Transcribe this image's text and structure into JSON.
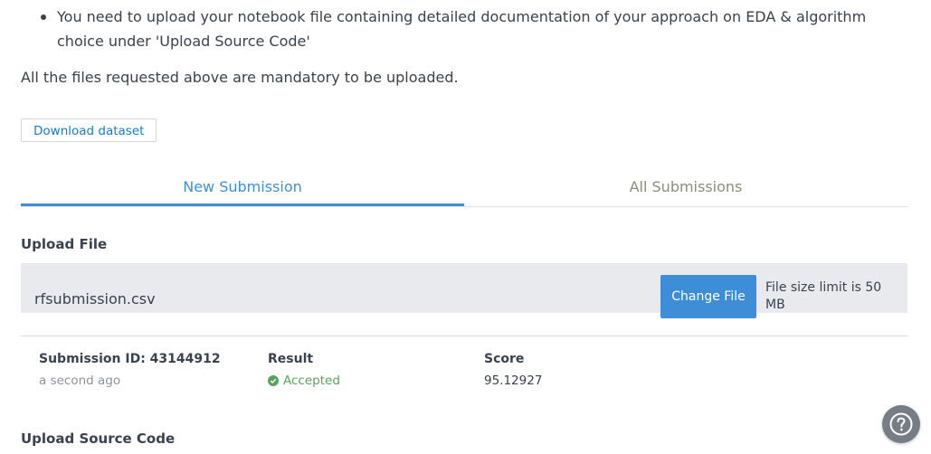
{
  "instructions": {
    "bullet": "You need to upload your notebook file containing detailed documentation of your approach on EDA & algorithm choice under 'Upload Source Code'",
    "mandatory_note": "All the files requested above are mandatory to be uploaded."
  },
  "download_button": "Download dataset",
  "tabs": [
    {
      "label": "New Submission",
      "active": true
    },
    {
      "label": "All Submissions",
      "active": false
    }
  ],
  "upload_file": {
    "title": "Upload File",
    "filename": "rfsubmission.csv",
    "change_button": "Change File",
    "size_limit": "File size limit is 50 MB"
  },
  "submission": {
    "id_label": "Submission ID: 43144912",
    "time": "a second ago",
    "result_label": "Result",
    "result_value": "Accepted",
    "score_label": "Score",
    "score_value": "95.12927"
  },
  "upload_source_code": {
    "title": "Upload Source Code"
  },
  "colors": {
    "accent": "#3f8fd8",
    "button": "#3e8ed7",
    "success": "#5aa35e",
    "help_button": "#777d84"
  },
  "icons": {
    "accepted": "check-circle-icon",
    "help": "question-circle-icon"
  }
}
